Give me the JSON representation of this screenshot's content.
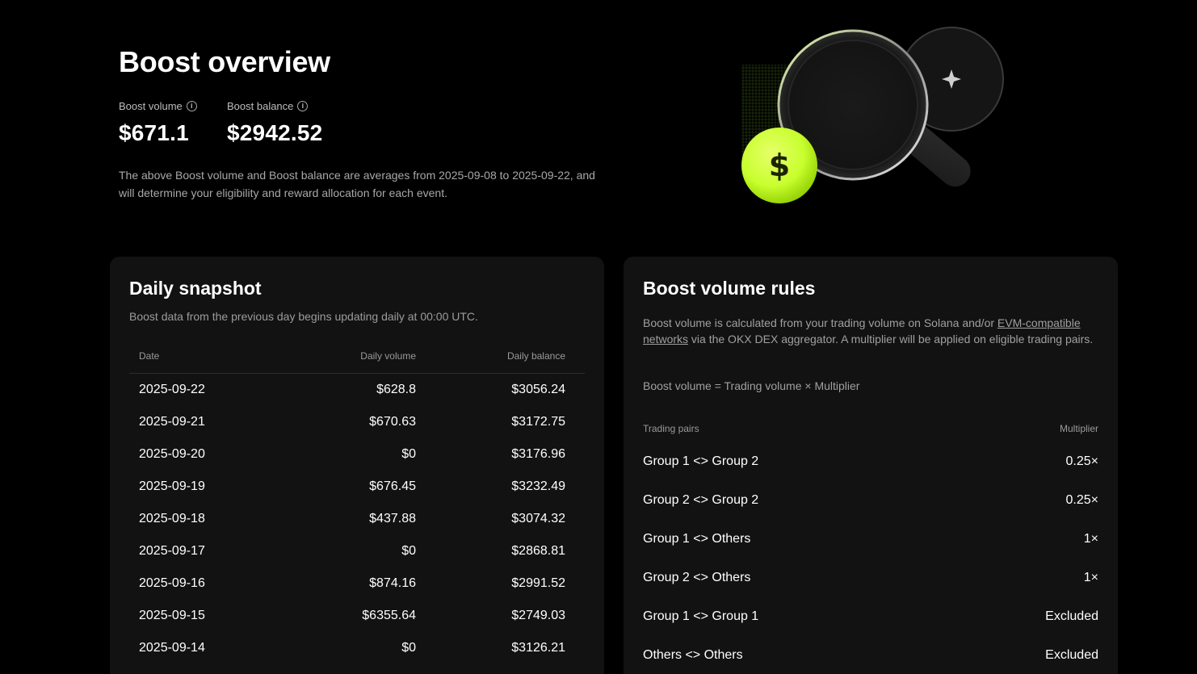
{
  "overview": {
    "title": "Boost overview",
    "boost_volume_label": "Boost volume",
    "boost_volume_value": "$671.1",
    "boost_balance_label": "Boost balance",
    "boost_balance_value": "$2942.52",
    "description": "The above Boost volume and Boost balance are averages from 2025-09-08 to 2025-09-22, and will determine your eligibility and reward allocation for each event."
  },
  "hero": {
    "coin_symbol": "$",
    "accent_color": "#c8ff2e"
  },
  "snapshot": {
    "title": "Daily snapshot",
    "subtitle": "Boost data from the previous day begins updating daily at 00:00 UTC.",
    "columns": [
      "Date",
      "Daily volume",
      "Daily balance"
    ],
    "rows": [
      {
        "date": "2025-09-22",
        "volume": "$628.8",
        "balance": "$3056.24"
      },
      {
        "date": "2025-09-21",
        "volume": "$670.63",
        "balance": "$3172.75"
      },
      {
        "date": "2025-09-20",
        "volume": "$0",
        "balance": "$3176.96"
      },
      {
        "date": "2025-09-19",
        "volume": "$676.45",
        "balance": "$3232.49"
      },
      {
        "date": "2025-09-18",
        "volume": "$437.88",
        "balance": "$3074.32"
      },
      {
        "date": "2025-09-17",
        "volume": "$0",
        "balance": "$2868.81"
      },
      {
        "date": "2025-09-16",
        "volume": "$874.16",
        "balance": "$2991.52"
      },
      {
        "date": "2025-09-15",
        "volume": "$6355.64",
        "balance": "$2749.03"
      },
      {
        "date": "2025-09-14",
        "volume": "$0",
        "balance": "$3126.21"
      }
    ]
  },
  "rules": {
    "title": "Boost volume rules",
    "text_before_link": "Boost volume is calculated from your trading volume on Solana and/or ",
    "link_text": "EVM-compatible networks",
    "text_after_link": " via the OKX DEX aggregator. A multiplier will be applied on eligible trading pairs.",
    "formula": "Boost volume = Trading volume × Multiplier",
    "columns": [
      "Trading pairs",
      "Multiplier"
    ],
    "pairs": [
      {
        "pair": "Group 1 <> Group 2",
        "multiplier": "0.25×"
      },
      {
        "pair": "Group 2 <> Group 2",
        "multiplier": "0.25×"
      },
      {
        "pair": "Group 1 <> Others",
        "multiplier": "1×"
      },
      {
        "pair": "Group 2 <> Others",
        "multiplier": "1×"
      },
      {
        "pair": "Group 1 <> Group 1",
        "multiplier": "Excluded"
      },
      {
        "pair": "Others <> Others",
        "multiplier": "Excluded"
      }
    ]
  }
}
